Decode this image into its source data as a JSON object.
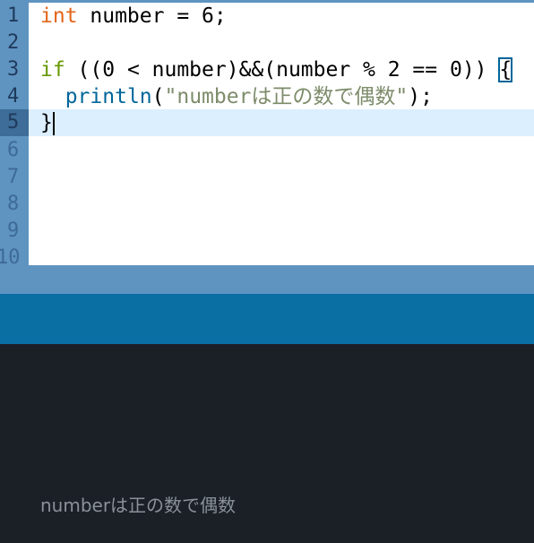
{
  "editor": {
    "line_numbers": [
      "1",
      "2",
      "3",
      "4",
      "5",
      "6",
      "7",
      "8",
      "9",
      "10"
    ],
    "current_line": 5,
    "lines": {
      "l1": {
        "kw": "int",
        "rest": " number = 6;"
      },
      "l3": {
        "kw": "if",
        "rest": " ((0 < number)&&(number % 2 == 0)) ",
        "brace": "{"
      },
      "l4": {
        "indent": "  ",
        "fn": "println",
        "open": "(",
        "str": "\"numberは正の数で偶数\"",
        "close": ");"
      },
      "l5": {
        "brace": "}"
      }
    }
  },
  "console": {
    "output": "numberは正の数で偶数"
  },
  "colors": {
    "gutter": "#5f94c1",
    "toolbar": "#0a6fa3",
    "console_bg": "#1b1f26",
    "keyword_type": "#e2661a",
    "keyword_control": "#669900",
    "function": "#006699",
    "string": "#7d8c6b"
  }
}
